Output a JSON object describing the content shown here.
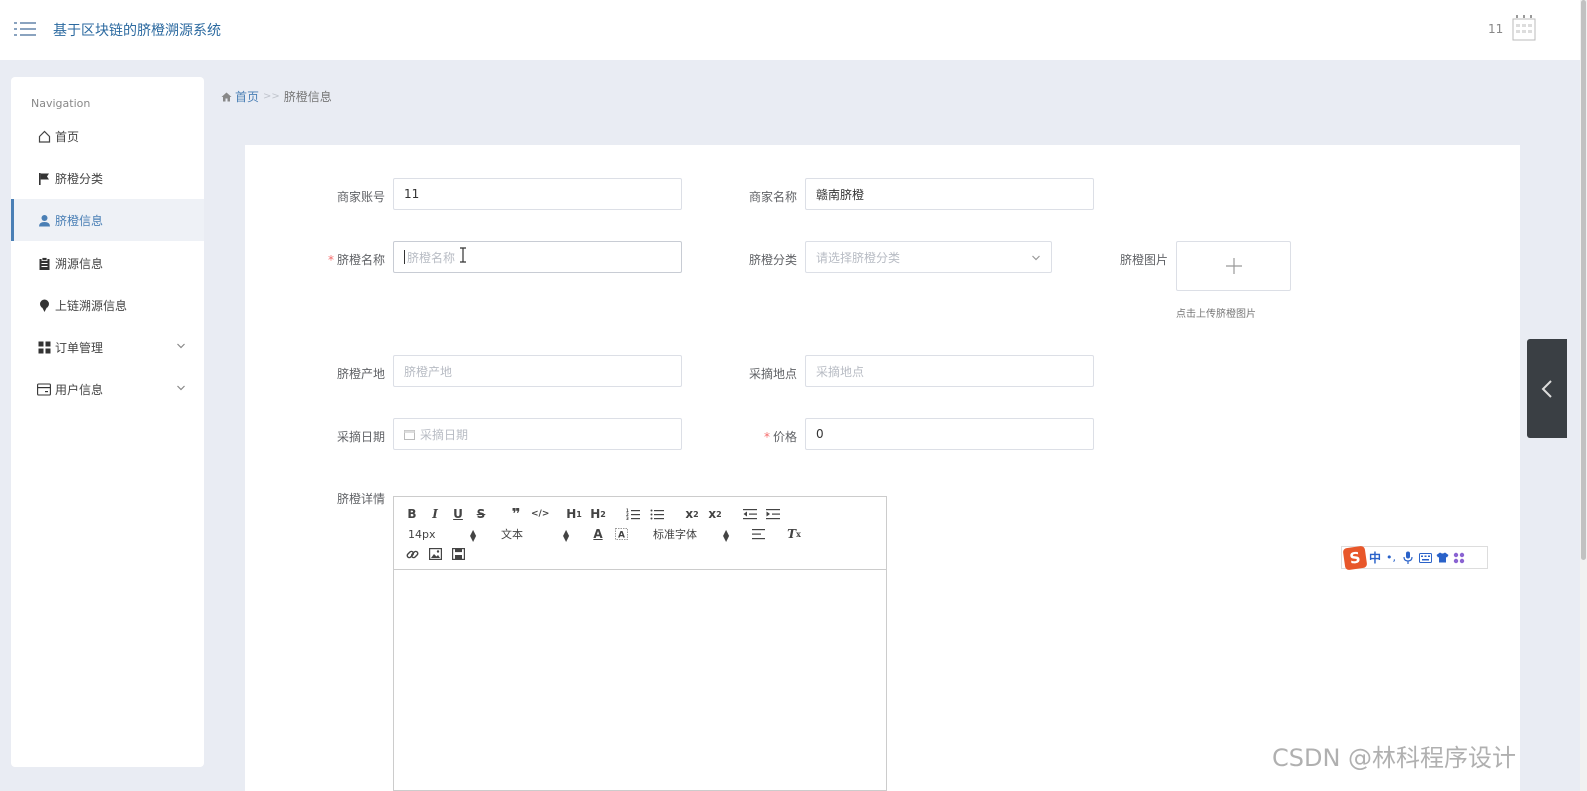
{
  "header": {
    "title": "基于区块链的脐橙溯源系统",
    "user": "11"
  },
  "sidebar": {
    "heading": "Navigation",
    "items": [
      {
        "label": "首页",
        "icon": "home-icon"
      },
      {
        "label": "脐橙分类",
        "icon": "flag-icon"
      },
      {
        "label": "脐橙信息",
        "icon": "user-icon",
        "active": true
      },
      {
        "label": "溯源信息",
        "icon": "clipboard-icon"
      },
      {
        "label": "上链溯源信息",
        "icon": "pin-icon"
      },
      {
        "label": "订单管理",
        "icon": "grid-icon",
        "expandable": true
      },
      {
        "label": "用户信息",
        "icon": "card-icon",
        "expandable": true
      }
    ]
  },
  "breadcrumb": {
    "home": "首页",
    "separator": ">>",
    "current": "脐橙信息"
  },
  "form": {
    "merchant_account": {
      "label": "商家账号",
      "value": "11"
    },
    "merchant_name": {
      "label": "商家名称",
      "value": "赣南脐橙"
    },
    "orange_name": {
      "label": "脐橙名称",
      "required": true,
      "placeholder": "脐橙名称"
    },
    "orange_category": {
      "label": "脐橙分类",
      "placeholder": "请选择脐橙分类"
    },
    "orange_image": {
      "label": "脐橙图片",
      "hint": "点击上传脐橙图片"
    },
    "origin": {
      "label": "脐橙产地",
      "placeholder": "脐橙产地"
    },
    "pick_location": {
      "label": "采摘地点",
      "placeholder": "采摘地点"
    },
    "pick_date": {
      "label": "采摘日期",
      "placeholder": "采摘日期"
    },
    "price": {
      "label": "价格",
      "required": true,
      "value": "0"
    },
    "details": {
      "label": "脐橙详情"
    }
  },
  "editor": {
    "font_size": "14px",
    "paragraph": "文本",
    "font_family": "标准字体",
    "buttons": [
      "B",
      "I",
      "U",
      "S",
      "❞",
      "</>",
      "H1",
      "H2",
      "ol",
      "ul",
      "x₂",
      "x²",
      "outdent",
      "indent",
      "color",
      "background",
      "align",
      "clean",
      "link",
      "image",
      "video"
    ]
  },
  "ime": {
    "logo": "S",
    "mode": "中",
    "punct": "•,"
  },
  "watermark": "CSDN @林科程序设计"
}
